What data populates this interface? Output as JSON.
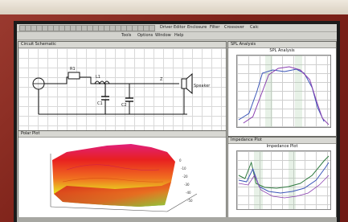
{
  "toolbar": {
    "buttons_row1": 24,
    "labels_row1": [
      "Driver Editor",
      "Enclosure",
      "Filter",
      "Crossover",
      "Calc"
    ],
    "labels_row2": [
      "Tools",
      "Options",
      "Window",
      "Help"
    ]
  },
  "schematic": {
    "title": "Circuit Schematic",
    "labels": [
      "R1",
      "L1",
      "C1",
      "C2",
      "Z",
      "Speaker"
    ]
  },
  "surface": {
    "title": "Polar Plot",
    "axis_labels": [
      "0",
      "-10",
      "-20",
      "-30",
      "-40",
      "-50"
    ]
  },
  "spl_plot": {
    "title": "SPL Analysis"
  },
  "impedance_plot": {
    "title": "Impedance Plot"
  },
  "colors": {
    "trace_blue": "#3a55b8",
    "trace_purple": "#8a3fb0",
    "trace_green": "#2f7a3f",
    "surface_red": "#e82020",
    "surface_yellow": "#e8e020",
    "surface_green": "#40b040"
  }
}
